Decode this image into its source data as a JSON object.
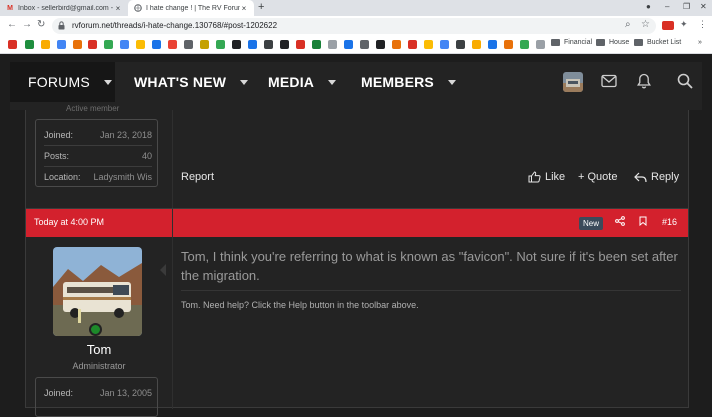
{
  "browser": {
    "tabs": [
      {
        "title": "Inbox - sellerbird@gmail.com - G",
        "favicon": "gmail-icon"
      },
      {
        "title": "I hate change ! | The RV Forum C",
        "favicon": "rv-forum-icon"
      }
    ],
    "url": "rvforum.net/threads/i-hate-change.130768/#post-1202622",
    "bookmark_folders": [
      "Financial",
      "House",
      "Bucket List"
    ],
    "overflow": "»"
  },
  "nav": {
    "items": [
      {
        "label": "FORUMS",
        "active": true
      },
      {
        "label": "WHAT'S NEW"
      },
      {
        "label": "MEDIA"
      },
      {
        "label": "MEMBERS"
      }
    ]
  },
  "post1": {
    "user_role": "Active member",
    "stats": [
      {
        "label": "Joined:",
        "value": "Jan 23, 2018"
      },
      {
        "label": "Posts:",
        "value": "40"
      },
      {
        "label": "Location:",
        "value": "Ladysmith Wis"
      }
    ],
    "report": "Report",
    "like": "Like",
    "quote": "+ Quote",
    "reply": "Reply"
  },
  "post2": {
    "date": "Today at 4:00 PM",
    "badge": "New",
    "number": "#16",
    "username": "Tom",
    "role": "Administrator",
    "joined_label": "Joined:",
    "joined_value": "Jan 13, 2005",
    "message": "Tom, I think you're referring to what is known as \"favicon\". Not sure if it's been set after the migration.",
    "signature": "Tom. Need help? Click the Help button in the toolbar above."
  },
  "colors": {
    "accent": "#d3212d",
    "page_bg": "#1d1d1d",
    "panel_bg": "#232323",
    "online": "#1d8a2a"
  }
}
